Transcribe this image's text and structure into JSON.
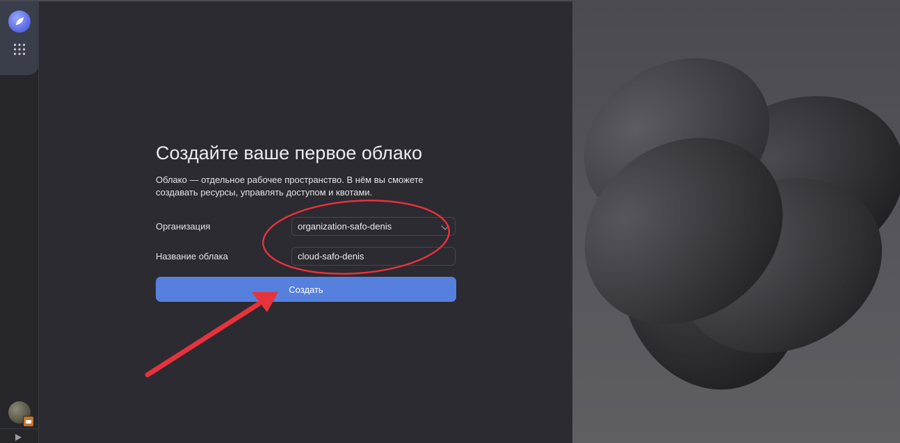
{
  "page": {
    "title": "Создайте ваше первое облако",
    "description": "Облако — отдельное рабочее пространство. В нём вы сможете создавать ресурсы, управлять доступом и квотами."
  },
  "form": {
    "organization_label": "Организация",
    "organization_value": "organization-safo-denis",
    "cloud_name_label": "Название облака",
    "cloud_name_value": "cloud-safo-denis",
    "submit_label": "Создать"
  },
  "sidebar": {
    "top_icons": [
      "logo-icon",
      "apps-grid-icon"
    ],
    "bottom_icons": [
      "user-avatar",
      "expand-icon"
    ]
  },
  "colors": {
    "background": "#2b2b31",
    "accent_button": "#5680de",
    "annotation_red": "#e8323c"
  }
}
